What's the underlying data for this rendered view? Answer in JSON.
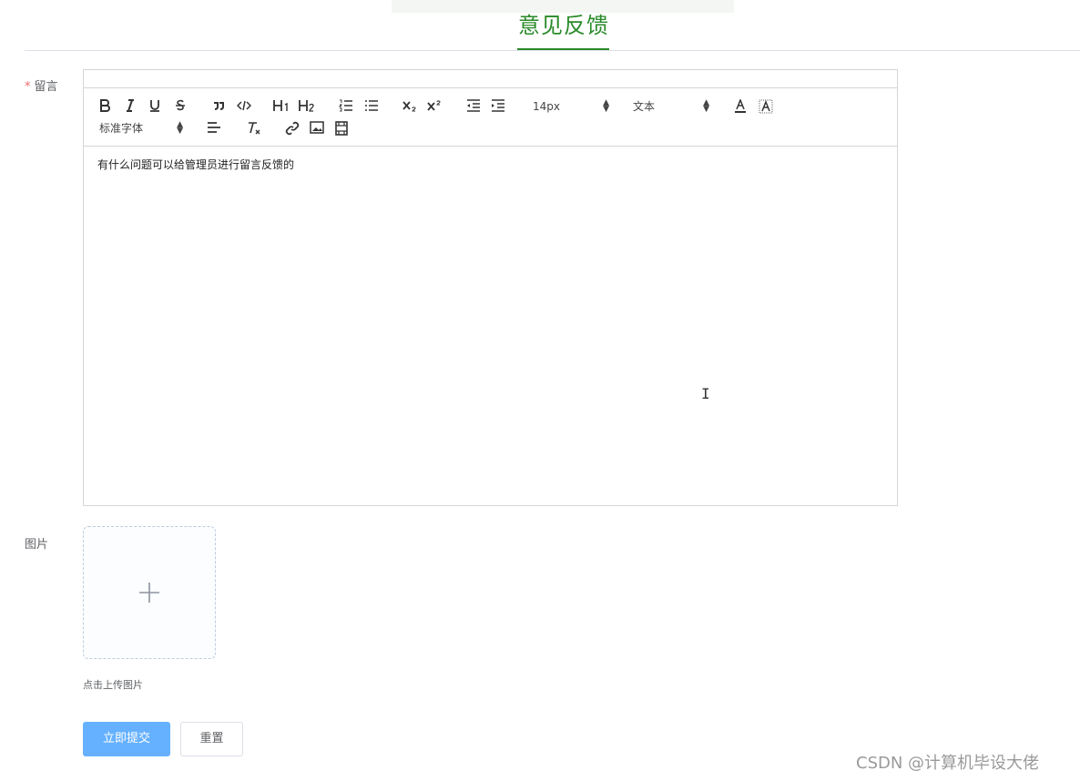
{
  "header": {
    "title": "意见反馈",
    "accent_color": "#2a8a2a"
  },
  "form": {
    "message_label": "留言",
    "required_mark": "*",
    "image_label": "图片"
  },
  "editor": {
    "toolbar": {
      "font_size": "14px",
      "heading_type": "文本",
      "font_family": "标准字体"
    },
    "content": "有什么问题可以给管理员进行留言反馈的"
  },
  "upload": {
    "tip": "点击上传图片"
  },
  "buttons": {
    "submit": "立即提交",
    "reset": "重置",
    "submit_color": "#66b1ff"
  },
  "watermark": "CSDN @计算机毕设大佬"
}
